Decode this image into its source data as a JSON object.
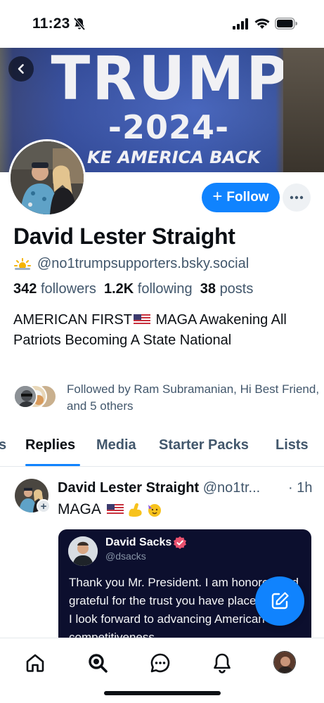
{
  "status_bar": {
    "time": "11:23"
  },
  "banner": {
    "line1": "TRUMP",
    "line2": "-2024-",
    "line3": "KE AMERICA BACK"
  },
  "profile": {
    "follow_label": "Follow",
    "display_name": "David Lester Straight",
    "handle": "@no1trumpsupporters.bsky.social",
    "followers_count": "342",
    "followers_label": "followers",
    "following_count": "1.2K",
    "following_label": "following",
    "posts_count": "38",
    "posts_label": "posts",
    "bio_part1": "AMERICAN FIRST",
    "bio_part2": " MAGA Awakening All Patriots Becoming A State National",
    "followed_by": "Followed by Ram Subramanian, Hi Best Friend, and 5 others"
  },
  "tabs": [
    {
      "label": "s"
    },
    {
      "label": "Replies",
      "active": true
    },
    {
      "label": "Media"
    },
    {
      "label": "Starter Packs"
    },
    {
      "label": "Lists"
    }
  ],
  "post": {
    "author_name": "David Lester Straight",
    "author_handle": "@no1tr...",
    "time": "· 1h",
    "text": "MAGA",
    "quote": {
      "name": "David Sacks",
      "handle": "@dsacks",
      "text": "Thank you Mr. President. I am honored and grateful for the trust you have placed in me. I look forward to advancing American competitiveness"
    }
  },
  "nav": [
    "home-icon",
    "search-icon",
    "chat-icon",
    "bell-icon",
    "profile-avatar"
  ],
  "colors": {
    "accent": "#1083fe",
    "muted": "#42576c",
    "quote_bg": "#0c0f2e"
  }
}
